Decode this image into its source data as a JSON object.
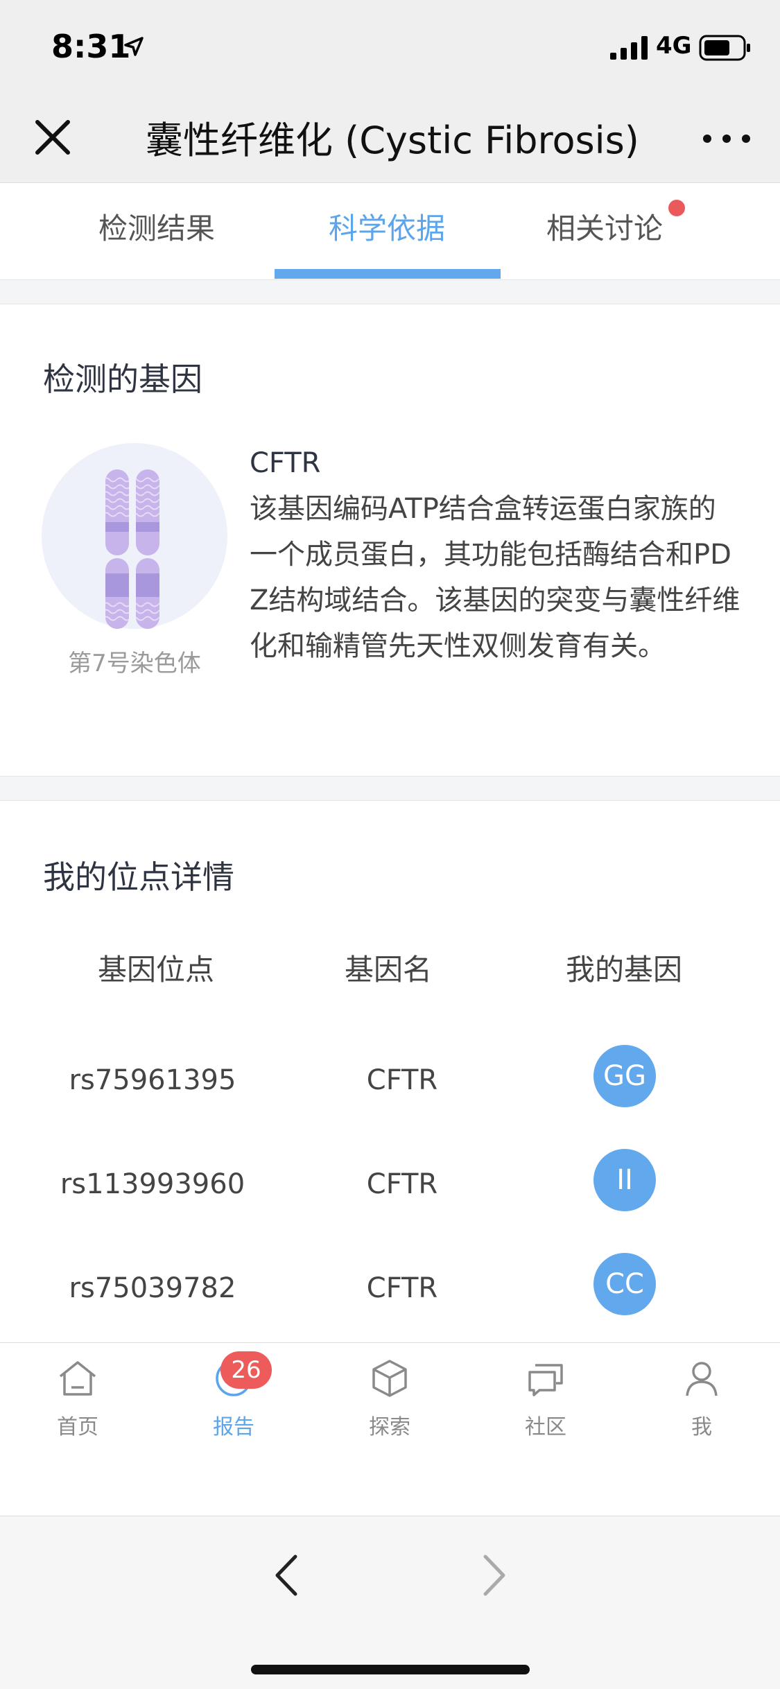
{
  "status_bar": {
    "time": "8:31",
    "network": "4G"
  },
  "nav": {
    "title": "囊性纤维化 (Cystic Fibrosis)"
  },
  "tabs": [
    {
      "label": "检测结果"
    },
    {
      "label": "科学依据"
    },
    {
      "label": "相关讨论"
    }
  ],
  "gene_section": {
    "title": "检测的基因",
    "chromosome_label": "第7号染色体",
    "gene_name": "CFTR",
    "description": "该基因编码ATP结合盒转运蛋白家族的一个成员蛋白，其功能包括酶结合和PDZ结构域结合。该基因的突变与囊性纤维化和输精管先天性双侧发育有关。"
  },
  "sites_section": {
    "title": "我的位点详情",
    "headers": [
      "基因位点",
      "基因名",
      "我的基因"
    ],
    "rows": [
      {
        "rsid": "rs75961395",
        "gene": "CFTR",
        "genotype": "GG"
      },
      {
        "rsid": "rs113993960",
        "gene": "CFTR",
        "genotype": "II"
      },
      {
        "rsid": "rs75039782",
        "gene": "CFTR",
        "genotype": "CC"
      }
    ]
  },
  "bottom_tabs": [
    {
      "label": "首页",
      "icon": "home-icon"
    },
    {
      "label": "报告",
      "icon": "report-icon",
      "badge": "26"
    },
    {
      "label": "探索",
      "icon": "cube-icon"
    },
    {
      "label": "社区",
      "icon": "chat-icon"
    },
    {
      "label": "我",
      "icon": "person-icon"
    }
  ],
  "colors": {
    "accent": "#5aa5ec",
    "badge": "#ee5b5b",
    "genotype_bg": "#62a8ec"
  }
}
